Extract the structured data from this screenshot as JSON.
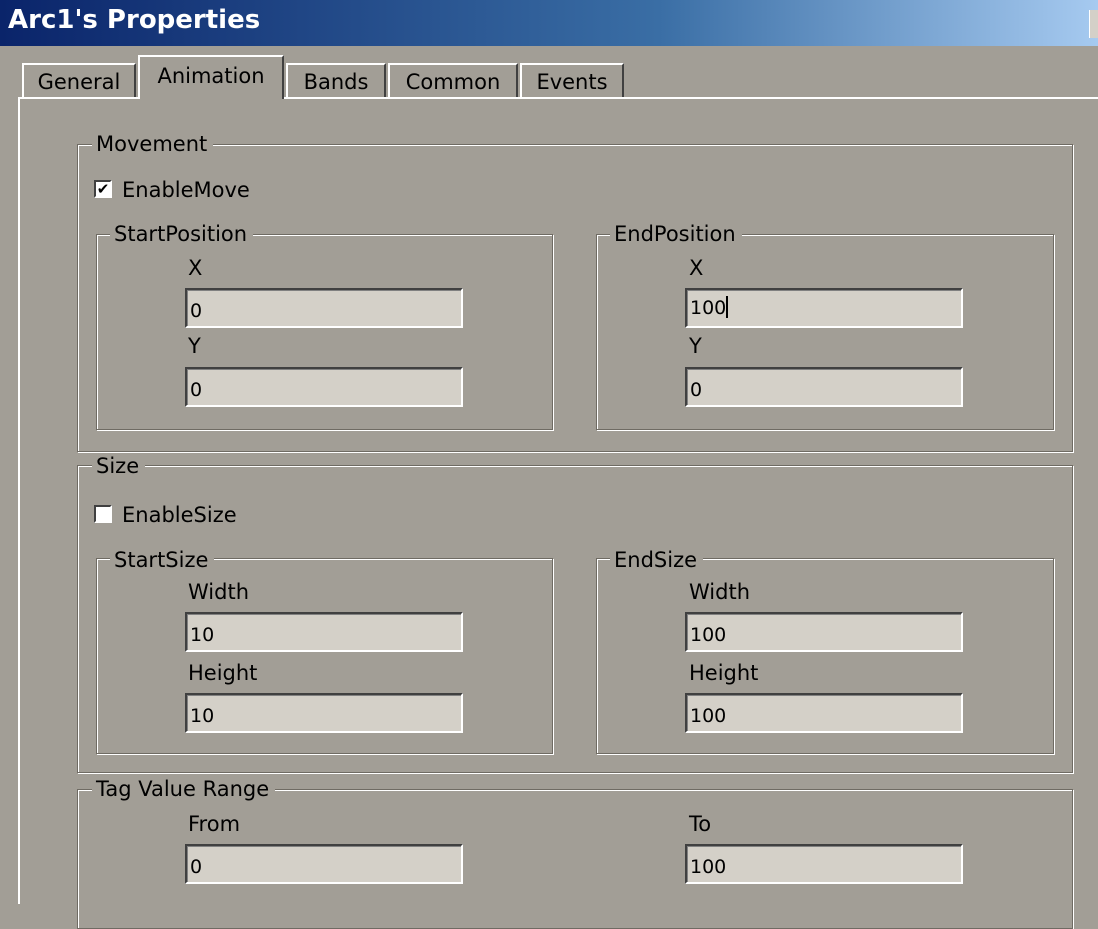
{
  "window": {
    "title": "Arc1's Properties"
  },
  "tabs": [
    {
      "label": "General",
      "active": false
    },
    {
      "label": "Animation",
      "active": true
    },
    {
      "label": "Bands",
      "active": false
    },
    {
      "label": "Common",
      "active": false
    },
    {
      "label": "Events",
      "active": false
    }
  ],
  "movement": {
    "label": "Movement",
    "enable_move": {
      "label": "EnableMove",
      "checked": true,
      "glyph": "✔"
    },
    "start_position": {
      "label": "StartPosition",
      "x_label": "X",
      "x_value": "0",
      "y_label": "Y",
      "y_value": "0"
    },
    "end_position": {
      "label": "EndPosition",
      "x_label": "X",
      "x_value": "100",
      "y_label": "Y",
      "y_value": "0"
    }
  },
  "size": {
    "label": "Size",
    "enable_size": {
      "label": "EnableSize",
      "checked": false,
      "glyph": ""
    },
    "start_size": {
      "label": "StartSize",
      "width_label": "Width",
      "width_value": "10",
      "height_label": "Height",
      "height_value": "10"
    },
    "end_size": {
      "label": "EndSize",
      "width_label": "Width",
      "width_value": "100",
      "height_label": "Height",
      "height_value": "100"
    }
  },
  "tag_value_range": {
    "label": "Tag Value Range",
    "from_label": "From",
    "from_value": "0",
    "to_label": "To",
    "to_value": "100"
  }
}
